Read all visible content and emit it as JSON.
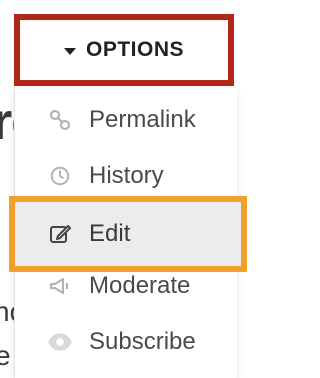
{
  "background": {
    "fragment_big": "re",
    "fragment_small_1": "nc",
    "fragment_small_2": "e"
  },
  "options_button": {
    "label": "OPTIONS",
    "icon": "caret-down-icon",
    "border_color": "#b02718"
  },
  "menu": {
    "items": [
      {
        "label": "Permalink",
        "icon": "link-icon"
      },
      {
        "label": "History",
        "icon": "clock-icon"
      },
      {
        "label": "Edit",
        "icon": "edit-icon",
        "highlighted": true,
        "highlight_color": "#f0a02b"
      },
      {
        "label": "Moderate",
        "icon": "megaphone-icon"
      },
      {
        "label": "Subscribe",
        "icon": "eye-icon"
      }
    ]
  }
}
